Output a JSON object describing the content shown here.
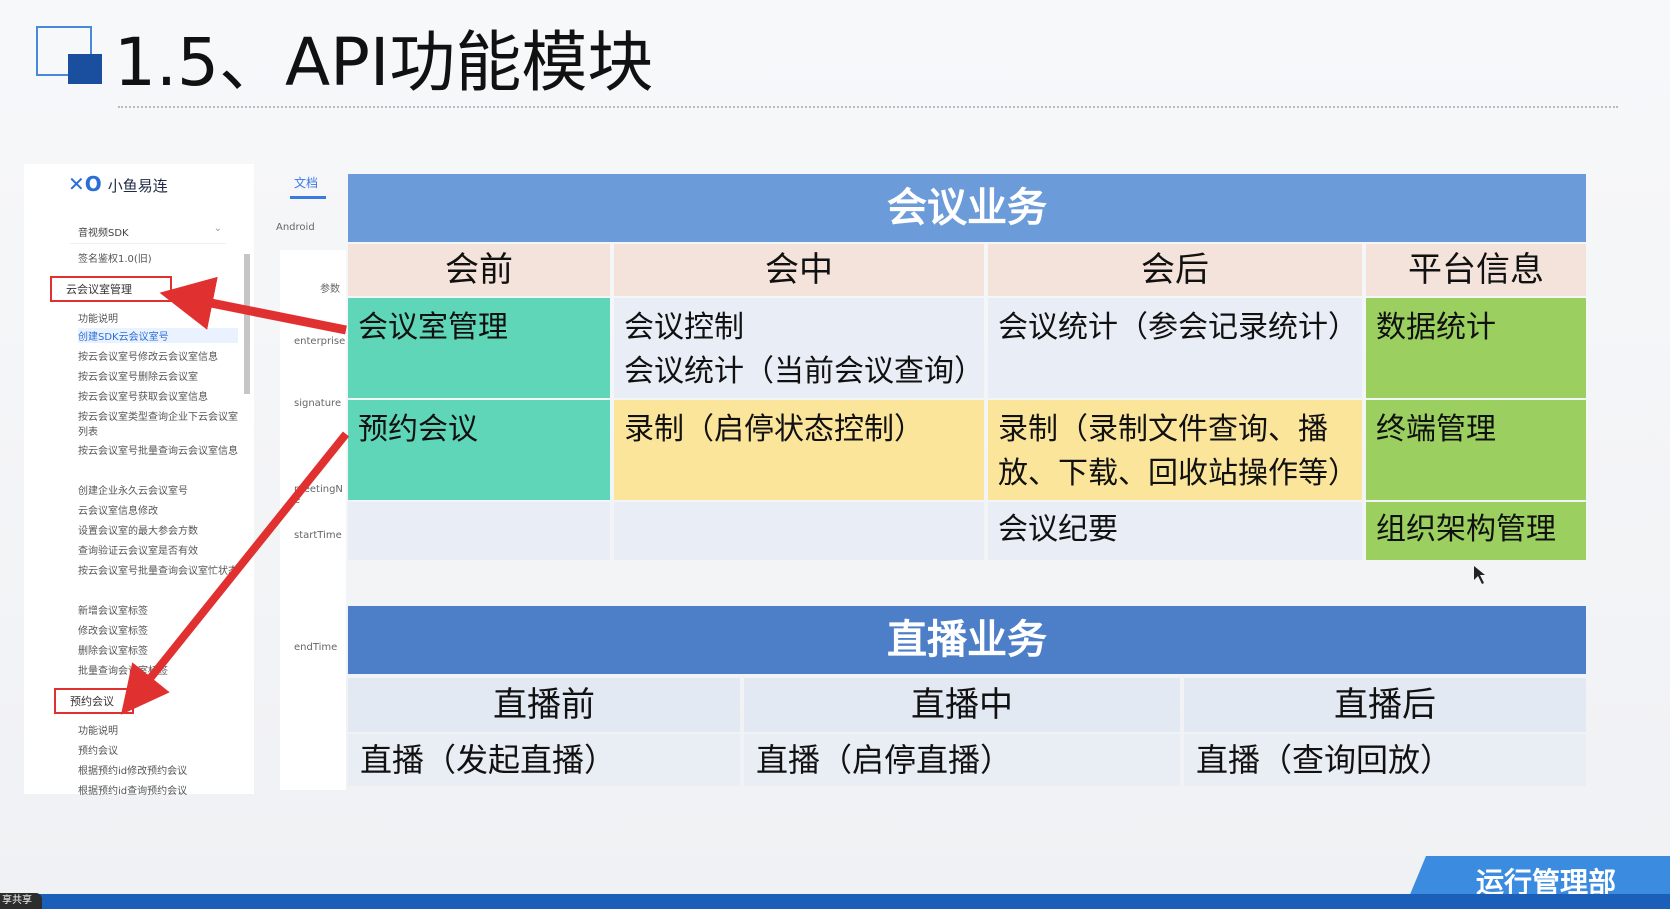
{
  "slide": {
    "title": "1.5、API功能模块",
    "department": "运行管理部",
    "corner_tag": "享共享"
  },
  "sidebar": {
    "logo": "小鱼易连",
    "doc_tab": "文档",
    "sdk_select": "音视频SDK",
    "platform_tab": "Android",
    "items": [
      "签名鉴权1.0(旧)",
      "云会议室管理",
      "功能说明",
      "创建SDK云会议室号",
      "按云会议室号修改云会议室信息",
      "按云会议室号删除云会议室",
      "按云会议室号获取会议室信息",
      "按云会议室类型查询企业下云会议室列表",
      "按云会议室号批量查询云会议室信息",
      "创建企业永久云会议室号",
      "云会议室信息修改",
      "设置会议室的最大参会方数",
      "查询验证云会议室是否有效",
      "按云会议室号批量查询会议室忙状态",
      "新增会议室标签",
      "修改会议室标签",
      "删除会议室标签",
      "批量查询会议室标签",
      "预约会议",
      "功能说明",
      "预约会议",
      "根据预约id修改预约会议",
      "根据预约id查询预约会议"
    ],
    "params": {
      "header": "参数",
      "p1": "enterprise",
      "p2": "signature",
      "p3": "meetingN e",
      "p4": "startTime",
      "p5": "endTime"
    }
  },
  "meeting": {
    "title": "会议业务",
    "headers": [
      "会前",
      "会中",
      "会后",
      "平台信息"
    ],
    "row1": [
      "会议室管理",
      "会议控制\n会议统计（当前会议查询）",
      "会议统计（参会记录统计）",
      "数据统计"
    ],
    "row2": [
      "预约会议",
      "录制（启停状态控制）",
      "录制（录制文件查询、播\n放、下载、回收站操作等）",
      "终端管理"
    ],
    "row3": [
      "",
      "",
      "会议纪要",
      "组织架构管理"
    ]
  },
  "live": {
    "title": "直播业务",
    "headers": [
      "直播前",
      "直播中",
      "直播后"
    ],
    "values": [
      "直播（发起直播）",
      "直播（启停直播）",
      "直播（查询回放）"
    ]
  },
  "colors": {
    "meeting_header": "#6b9bd8",
    "live_header": "#4d7ec8",
    "teal": "#5fd6b8",
    "yellow": "#fbe59b",
    "green": "#9bcf5f",
    "arrow": "#e03030"
  }
}
